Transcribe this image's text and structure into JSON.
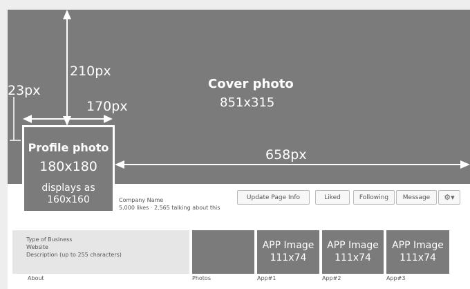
{
  "cover": {
    "title": "Cover photo",
    "size": "851x315"
  },
  "dimensions": {
    "vertical_210": "210px",
    "left_23": "23px",
    "width_170": "170px",
    "width_658": "658px"
  },
  "profile": {
    "title": "Profile photo",
    "size": "180x180",
    "display_line1": "displays as",
    "display_line2": "160x160"
  },
  "company": {
    "name": "Company Name",
    "stats": "5,000 likes · 2,565 talking about this"
  },
  "buttons": {
    "update": "Update Page Info",
    "liked": "Liked",
    "following": "Following",
    "message": "Message",
    "gear_icon": "gear-icon"
  },
  "about": {
    "line1": "Type of Business",
    "line2": "Website",
    "line3": "Description (up to 255 characters)",
    "label": "About"
  },
  "tabs": [
    {
      "label": "Photos"
    },
    {
      "title": "APP Image",
      "size": "111x74",
      "label": "App#1"
    },
    {
      "title": "APP Image",
      "size": "111x74",
      "label": "App#2"
    },
    {
      "title": "APP Image",
      "size": "111x74",
      "label": "App#3"
    }
  ],
  "colors": {
    "placeholder": "#7b7b7b",
    "background": "#eeeeee",
    "arrow": "#ffffff"
  }
}
